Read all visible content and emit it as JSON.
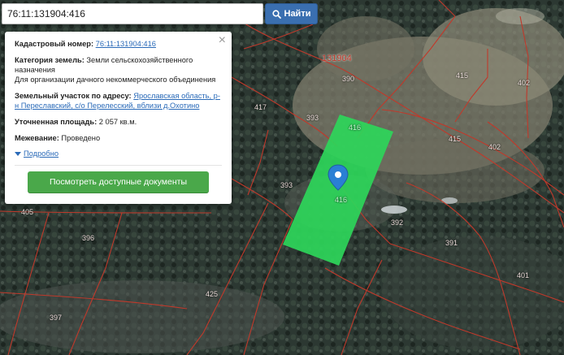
{
  "search": {
    "value": "76:11:131904:416",
    "button_label": "Найти"
  },
  "popup": {
    "cad_num_label": "Кадастровый номер:",
    "cad_num_value": "76:11:131904:416",
    "category_label": "Категория земель:",
    "category_value": "Земли сельскохозяйственного назначения",
    "usage_value": "Для организации дачного некоммерческого объединения",
    "address_label": "Земельный участок по адресу:",
    "address_value": "Ярославская область, р-н Переславский, с/о Перелесский, вблизи д.Охотино",
    "area_label": "Уточненная площадь:",
    "area_value": "2 057 кв.м.",
    "survey_label": "Межевание:",
    "survey_value": "Проведено",
    "details_label": "Подробно",
    "docs_button": "Посмотреть доступные документы",
    "close_symbol": "×"
  },
  "map": {
    "quarter_label": "131904",
    "parcel_labels": [
      "390",
      "415",
      "402",
      "417",
      "393",
      "415",
      "402",
      "393",
      "392",
      "391",
      "405",
      "396",
      "401",
      "425",
      "397",
      "416",
      "416"
    ],
    "selected_fill": "#2ed65a",
    "boundary_color": "#c0392b",
    "marker_color": "#2a7fd4"
  }
}
